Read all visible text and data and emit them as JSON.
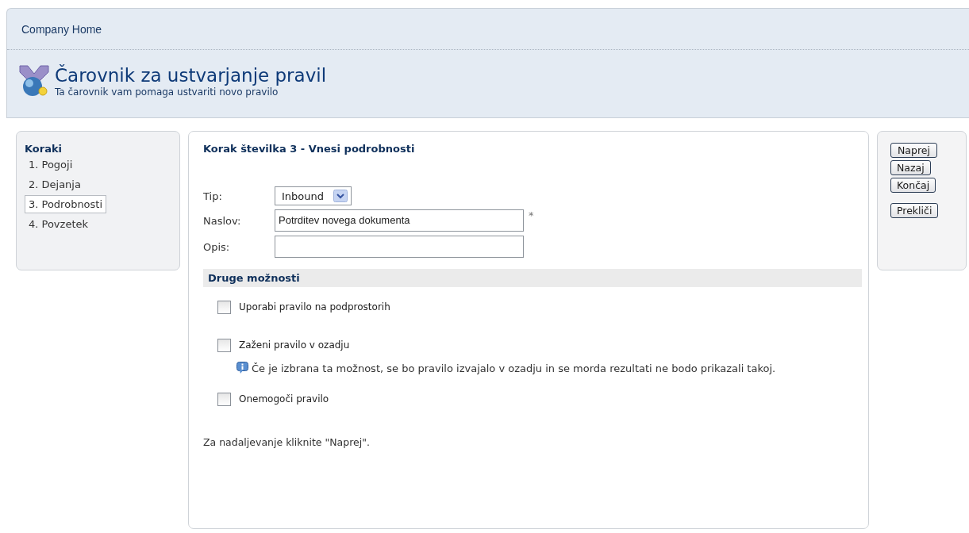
{
  "breadcrumb": "Company Home",
  "header": {
    "title": "Čarovnik za ustvarjanje pravil",
    "subtitle": "Ta čarovnik vam pomaga ustvariti novo pravilo"
  },
  "steps": {
    "title": "Koraki",
    "items": [
      {
        "label": "1. Pogoji",
        "selected": false
      },
      {
        "label": "2. Dejanja",
        "selected": false
      },
      {
        "label": "3. Podrobnosti",
        "selected": true
      },
      {
        "label": "4. Povzetek",
        "selected": false
      }
    ]
  },
  "form": {
    "heading": "Korak številka 3 - Vnesi podrobnosti",
    "fields": [
      {
        "kind": "select",
        "label": "Tip:",
        "value": "Inbound"
      },
      {
        "kind": "text",
        "label": "Naslov:",
        "value": "Potrditev novega dokumenta",
        "required_mark": "*"
      },
      {
        "kind": "text",
        "label": "Opis:"
      }
    ],
    "options_title": "Druge možnosti",
    "options": [
      {
        "label": "Uporabi pravilo na podprostorih",
        "checked": false
      },
      {
        "label": "Zaženi pravilo v ozadju",
        "checked": false,
        "note": "Če je izbrana ta možnost, se bo pravilo izvajalo v ozadju in se morda rezultati ne bodo prikazali takoj."
      },
      {
        "label": "Onemogoči pravilo",
        "checked": false
      }
    ],
    "footer": "Za nadaljevanje kliknite \"Naprej\"."
  },
  "buttons": [
    "Naprej",
    "Nazaj",
    "Končaj",
    "Prekliči"
  ]
}
